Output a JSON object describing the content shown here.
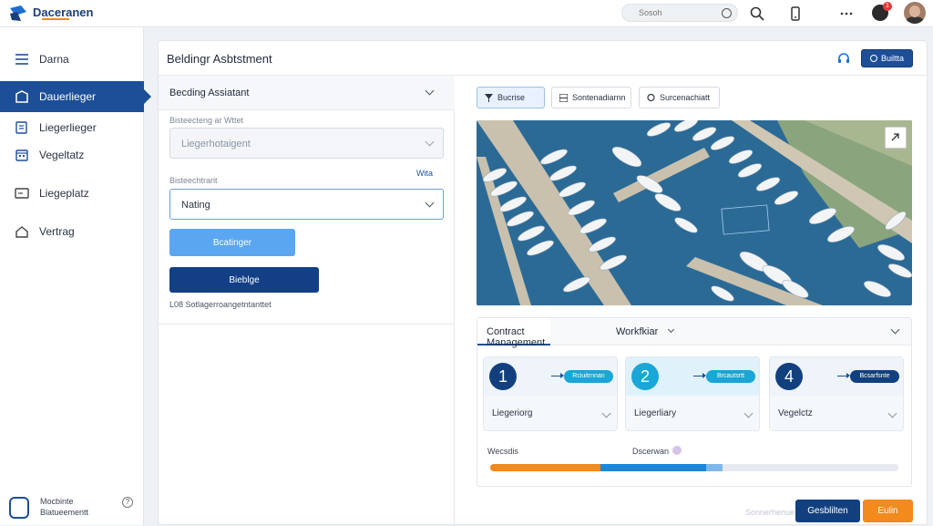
{
  "app": {
    "name": "Daceranen",
    "logo_icon": "brand-logo-icon",
    "accent": "#1d4f98",
    "orange": "#f28a1c"
  },
  "topbar": {
    "search_placeholder": "Sosoh",
    "notification_count": "1",
    "icons": [
      "search-icon",
      "phone-icon",
      "more-icon",
      "notification-icon",
      "avatar"
    ]
  },
  "sidebar": {
    "items": [
      {
        "label": "Darna",
        "icon": "menu-icon"
      },
      {
        "label": "Dauerlieger",
        "icon": "harbor-icon",
        "active": true
      },
      {
        "label": "Liegerlieger",
        "icon": "document-icon"
      },
      {
        "label": "Vegeltatz",
        "icon": "calendar-icon"
      },
      {
        "label": "Liegeplatz",
        "icon": "card-icon"
      },
      {
        "label": "Vertrag",
        "icon": "home-icon"
      }
    ],
    "footer": {
      "line1": "Mocbinte",
      "line2": "Blatueementt",
      "help": "?"
    }
  },
  "main": {
    "title": "Beldingr Asbtstment",
    "header_button": "Builtta"
  },
  "left_panel": {
    "title": "Becding Assiatant",
    "field1_label": "Bisteecteng ar Wttet",
    "field1_value": "Liegerhotaigent",
    "field2_label": "Bisteechtrarit",
    "field2_link": "Wita",
    "field2_value": "Nating",
    "btn_primary_light": "Bcatinger",
    "btn_primary_dark": "Bieblge",
    "footer_text": "L08 Sotlagerroangetntanttet"
  },
  "toolbar": {
    "buttons": [
      {
        "label": "Bucrise",
        "icon": "filter-icon"
      },
      {
        "label": "Sontenadiarnn",
        "icon": "grid-icon"
      },
      {
        "label": "Surcenachiatt",
        "icon": "chat-icon"
      }
    ]
  },
  "contract": {
    "tabs": [
      "Contract Management",
      "Workfkiar"
    ],
    "steps": [
      {
        "num": "1",
        "pill": "Rciuitrnnan",
        "label": "Liegeriorg",
        "color": "#12407f",
        "pill_color": "#1aa6d6"
      },
      {
        "num": "2",
        "pill": "Brcautsrtt",
        "label": "Liegerliary",
        "color": "#1aa6d6",
        "pill_color": "#1aa6d6"
      },
      {
        "num": "4",
        "pill": "Bcsarfsnte",
        "label": "Vegelctz",
        "color": "#12407f",
        "pill_color": "#12407f"
      }
    ],
    "progress_label1": "Wecsdis",
    "progress_label2": "Dscerwan",
    "progress": {
      "orange": 0.27,
      "blue": 0.26,
      "light": 0.04
    }
  },
  "footer": {
    "ghost": "Sonnerhenue",
    "save": "Gesblilten",
    "next": "Eulin"
  }
}
